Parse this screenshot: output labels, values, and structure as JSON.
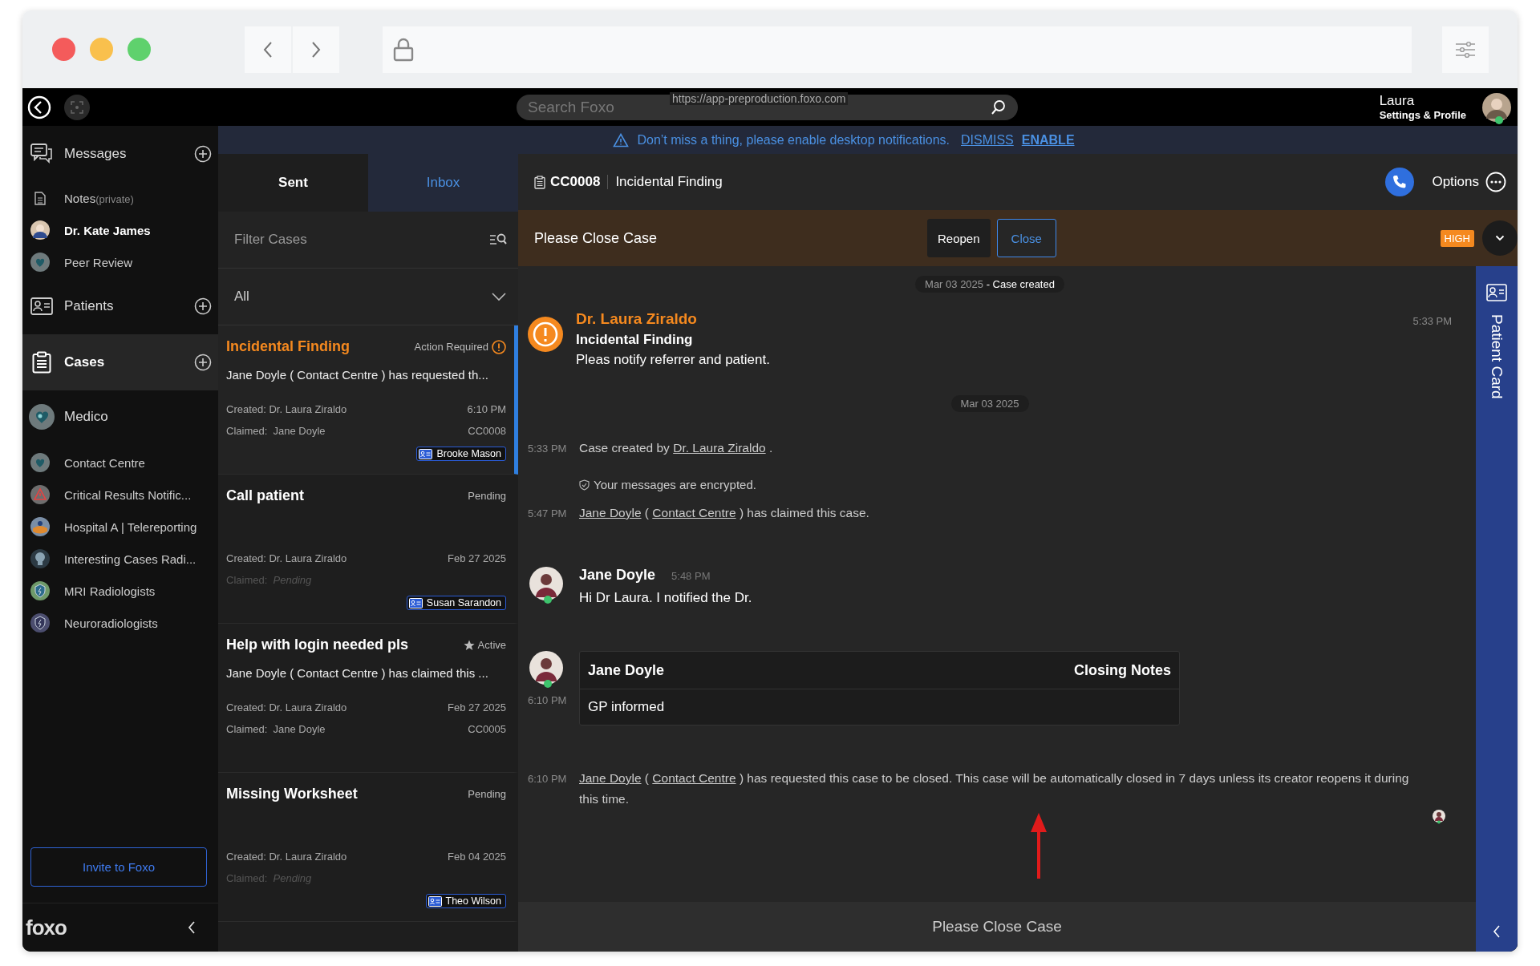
{
  "browser": {
    "url": "https://app-preproduction.foxo.com"
  },
  "topbar": {
    "search_placeholder": "Search Foxo",
    "user_name": "Laura",
    "user_link": "Settings & Profile",
    "online": true
  },
  "notification": {
    "text": "Don’t miss a thing, please enable desktop notifications.",
    "dismiss": "DISMISS",
    "enable": "ENABLE"
  },
  "sidebar": {
    "sections": [
      {
        "label": "Messages",
        "kind": "messages",
        "selected": false,
        "add": true,
        "items": [
          {
            "label": "Notes",
            "note": "(private)",
            "kind": "note",
            "unread": false
          },
          {
            "label": "Dr. Kate James",
            "kind": "person",
            "unread": true
          },
          {
            "label": "Peer Review",
            "kind": "group",
            "unread": false
          }
        ]
      },
      {
        "label": "Patients",
        "kind": "patients",
        "selected": false,
        "add": true
      },
      {
        "label": "Cases",
        "kind": "cases",
        "selected": true,
        "add": true
      },
      {
        "label": "Medico",
        "kind": "group",
        "selected": false,
        "add": false,
        "items": [
          {
            "label": "Contact Centre",
            "kind": "group",
            "unread": false
          },
          {
            "label": "Critical Results Notific...",
            "kind": "alert",
            "unread": false
          },
          {
            "label": "Hospital A | Telereporting",
            "kind": "hospital",
            "unread": false
          },
          {
            "label": "Interesting Cases Radi...",
            "kind": "xray",
            "unread": false
          },
          {
            "label": "MRI Radiologists",
            "kind": "shield",
            "unread": false
          },
          {
            "label": "Neuroradiologists",
            "kind": "shield-dark",
            "unread": false
          }
        ]
      }
    ],
    "invite": "Invite to Foxo",
    "logo": "foxo"
  },
  "case_list": {
    "tabs": [
      {
        "label": "Sent",
        "selected": false
      },
      {
        "label": "Inbox",
        "selected": true
      }
    ],
    "filter_placeholder": "Filter Cases",
    "dropdown": "All",
    "cases": [
      {
        "title": "Incidental Finding",
        "status": "Action Required",
        "kind": "action",
        "selected": true,
        "summary": "Jane Doyle ( Contact Centre ) has requested th...",
        "created": "Created: Dr. Laura Ziraldo",
        "time": "6:10 PM",
        "claimed_label": "Claimed:",
        "claimed": "Jane Doyle",
        "claimed_pending": false,
        "code": "CC0008",
        "patient": "Brooke Mason"
      },
      {
        "title": "Call patient",
        "status": "Pending",
        "kind": "pending",
        "selected": false,
        "created": "Created: Dr. Laura Ziraldo",
        "time": "Feb 27 2025",
        "claimed_label": "Claimed:",
        "claimed": "Pending",
        "claimed_pending": true,
        "patient": "Susan Sarandon"
      },
      {
        "title": "Help with login needed pls",
        "status": "Active",
        "kind": "active",
        "selected": false,
        "summary": "Jane Doyle ( Contact Centre ) has claimed this ...",
        "created": "Created: Dr. Laura Ziraldo",
        "time": "Feb 27 2025",
        "claimed_label": "Claimed:",
        "claimed": "Jane Doyle",
        "claimed_pending": false,
        "code": "CC0005"
      },
      {
        "title": "Missing Worksheet",
        "status": "Pending",
        "kind": "pending",
        "selected": false,
        "created": "Created: Dr. Laura Ziraldo",
        "time": "Feb 04 2025",
        "claimed_label": "Claimed:",
        "claimed": "Pending",
        "claimed_pending": true,
        "patient": "Theo Wilson"
      }
    ]
  },
  "case": {
    "code": "CC0008",
    "title": "Incidental Finding",
    "options": "Options",
    "status_text": "Please Close Case",
    "buttons": [
      {
        "label": "Reopen",
        "kind": "plain"
      },
      {
        "label": "Close",
        "kind": "outline"
      }
    ],
    "priority": "HIGH",
    "messages": [
      {
        "kind": "date",
        "date": "Mar 03 2025",
        "note": "- Case created"
      },
      {
        "kind": "alert",
        "author": "Dr. Laura Ziraldo",
        "title": "Incidental Finding",
        "text": "Pleas notify referrer and patient.",
        "time": "5:33 PM"
      },
      {
        "kind": "date",
        "date": "Mar 03 2025"
      },
      {
        "kind": "event",
        "time": "5:33 PM",
        "parts": [
          {
            "text": "Case created by ",
            "link": false
          },
          {
            "text": "Dr. Laura Ziraldo",
            "link": true
          },
          {
            "text": " .",
            "link": false
          }
        ]
      },
      {
        "kind": "encrypted",
        "text": "Your messages are encrypted."
      },
      {
        "kind": "event",
        "time": "5:47 PM",
        "parts": [
          {
            "text": "Jane Doyle",
            "link": true
          },
          {
            "text": " ( ",
            "link": false
          },
          {
            "text": "Contact Centre",
            "link": true
          },
          {
            "text": " ) has claimed this case.",
            "link": false
          }
        ]
      },
      {
        "kind": "message",
        "author": "Jane Doyle",
        "time": "5:48 PM",
        "text": "Hi Dr Laura. I notified the Dr.",
        "online": true
      },
      {
        "kind": "notes",
        "author": "Jane Doyle",
        "heading": "Closing Notes",
        "text": "GP informed",
        "time": "6:10 PM",
        "online": true
      },
      {
        "kind": "event",
        "time": "6:10 PM",
        "parts": [
          {
            "text": "Jane Doyle",
            "link": true
          },
          {
            "text": " ( ",
            "link": false
          },
          {
            "text": "Contact Centre",
            "link": true
          },
          {
            "text": " ) has requested this case to be closed. This case will be automatically closed in 7 days unless its creator reopens it during this time.",
            "link": false
          }
        ]
      },
      {
        "kind": "read_receipt"
      }
    ],
    "footer": "Please Close Case",
    "patient_card": "Patient Card"
  }
}
